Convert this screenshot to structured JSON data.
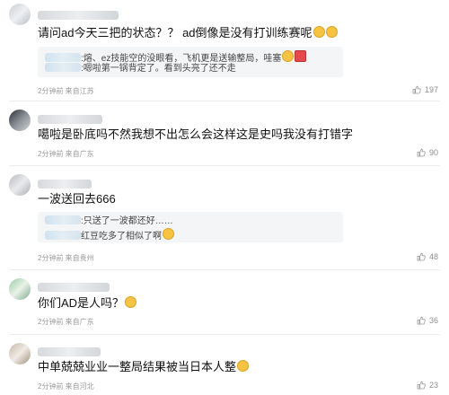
{
  "comments": [
    {
      "text": "请问ad今天三把的状态？？ ad倒像是没有打训练赛呢",
      "emojis": [
        "grin",
        "grin"
      ],
      "replies": [
        {
          "text": ":熔、ez技能空的没眼看，飞机更是送输整局，哇塞",
          "emojis": [
            "grin",
            "red"
          ]
        },
        {
          "text": ":嗯啦第一锅背定了。看到头亮了还不走",
          "emojis": []
        }
      ],
      "meta": "2分钟前 来自江苏",
      "likes": "197"
    },
    {
      "text": "噶啦是卧底吗不然我想不出怎么会这样这是史吗我没有打错字",
      "emojis": [],
      "replies": [],
      "meta": "2分钟前 来自广东",
      "likes": "90"
    },
    {
      "text": "一波送回去666",
      "emojis": [],
      "replies": [
        {
          "text": ":只送了一波都还好……",
          "emojis": []
        },
        {
          "text": "红豆吃多了相似了啊",
          "emojis": [
            "grin"
          ]
        }
      ],
      "meta": "2分钟前 来自贵州",
      "likes": "48"
    },
    {
      "text": "你们AD是人吗？",
      "emojis": [
        "grin"
      ],
      "replies": [],
      "meta": "2分钟前 来自广东",
      "likes": "36"
    },
    {
      "text": "中单兢兢业业一整局结果被当日本人整",
      "emojis": [
        "grin"
      ],
      "replies": [],
      "meta": "2分钟前 来自河北",
      "likes": "23"
    }
  ],
  "icons": {
    "like": "thumbs-up-icon",
    "avatar": "avatar"
  },
  "colors": {
    "meta": "#9a9a9a",
    "reply_bg": "#f4f5f6"
  }
}
